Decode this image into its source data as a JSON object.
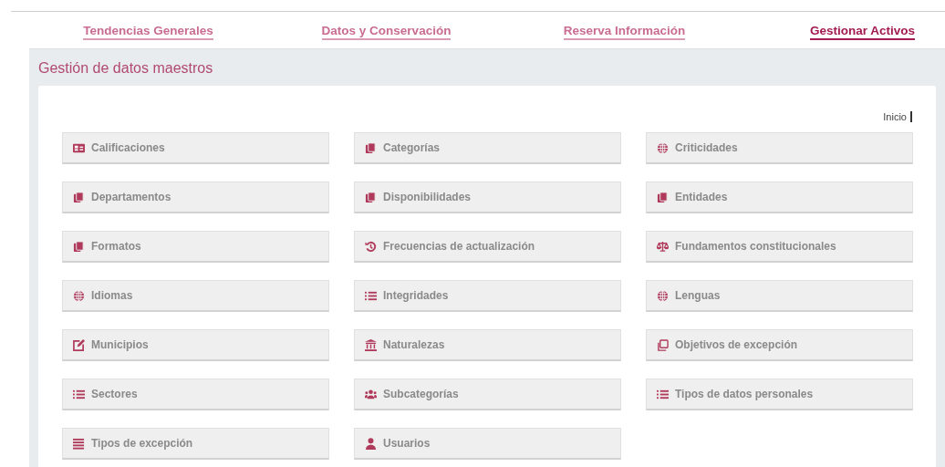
{
  "tabs": [
    {
      "label": "Tendencias Generales",
      "selected": false
    },
    {
      "label": "Datos y Conservación",
      "selected": false
    },
    {
      "label": "Reserva Información",
      "selected": false
    },
    {
      "label": "Gestionar Activos",
      "selected": true
    }
  ],
  "panel": {
    "title": "Gestión de datos maestros",
    "breadcrumb": "Inicio"
  },
  "items": [
    {
      "label": "Calificaciones",
      "kind": "card"
    },
    {
      "label": "Categorías",
      "kind": "copy"
    },
    {
      "label": "Criticidades",
      "kind": "globe"
    },
    {
      "label": "Departamentos",
      "kind": "copy"
    },
    {
      "label": "Disponibilidades",
      "kind": "copy"
    },
    {
      "label": "Entidades",
      "kind": "copy"
    },
    {
      "label": "Formatos",
      "kind": "copy"
    },
    {
      "label": "Frecuencias de actualización",
      "kind": "history"
    },
    {
      "label": "Fundamentos constitucionales",
      "kind": "scale"
    },
    {
      "label": "Idiomas",
      "kind": "globe"
    },
    {
      "label": "Integridades",
      "kind": "list"
    },
    {
      "label": "Lenguas",
      "kind": "globe"
    },
    {
      "label": "Municipios",
      "kind": "edit"
    },
    {
      "label": "Naturalezas",
      "kind": "bank"
    },
    {
      "label": "Objetivos de excepción",
      "kind": "clone"
    },
    {
      "label": "Sectores",
      "kind": "list"
    },
    {
      "label": "Subcategorías",
      "kind": "users"
    },
    {
      "label": "Tipos de datos personales",
      "kind": "list"
    },
    {
      "label": "Tipos de excepción",
      "kind": "bars"
    },
    {
      "label": "Usuarios",
      "kind": "user"
    }
  ]
}
